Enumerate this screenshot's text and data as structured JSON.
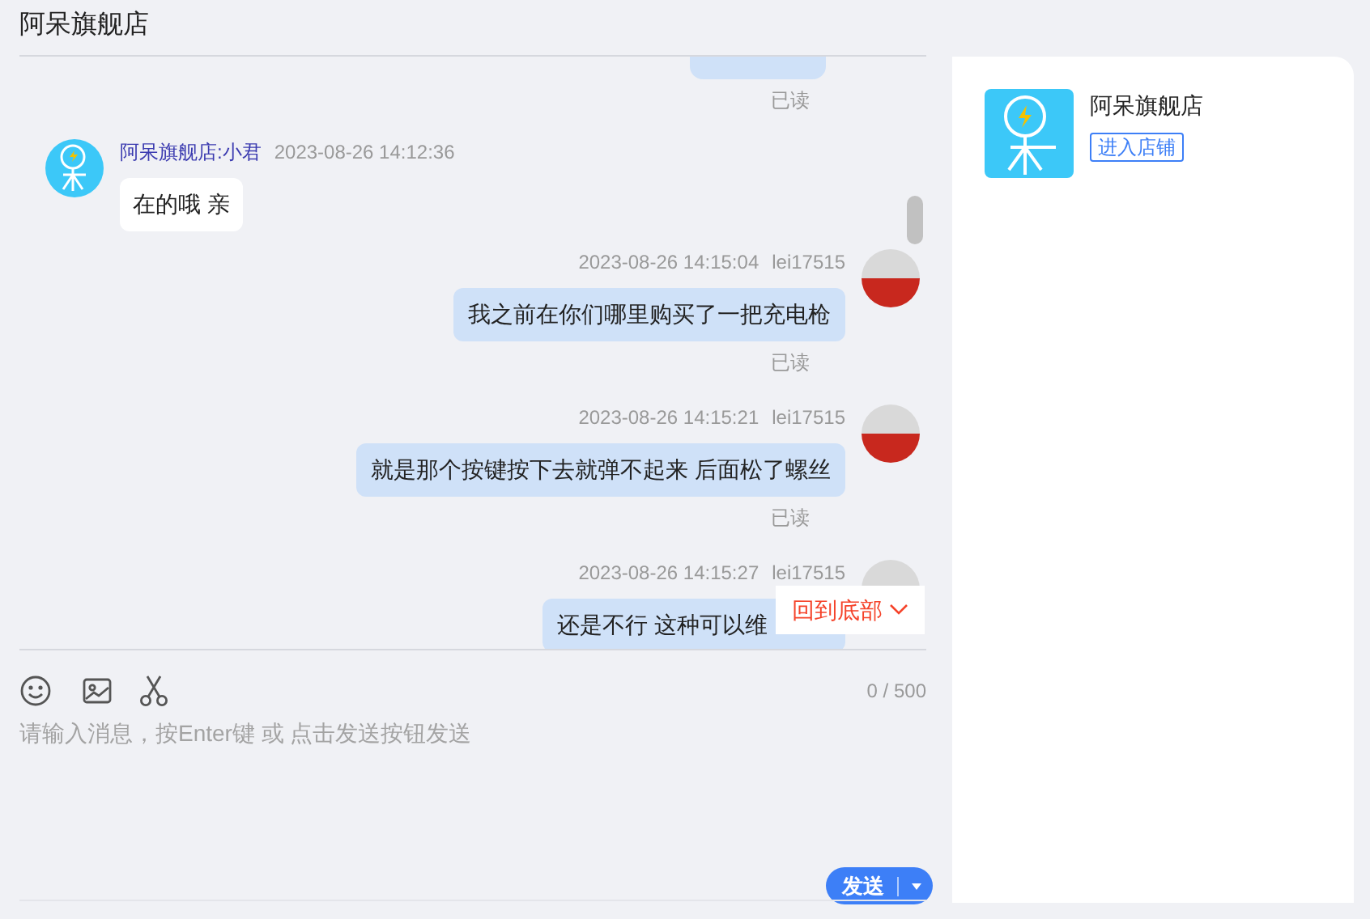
{
  "header": {
    "title": "阿呆旗舰店"
  },
  "messages": [
    {
      "kind": "partial",
      "outgoing": true,
      "read_status": "已读"
    },
    {
      "kind": "text",
      "outgoing": false,
      "sender": "阿呆旗舰店:小君",
      "time": "2023-08-26 14:12:36",
      "text": "在的哦 亲"
    },
    {
      "kind": "text",
      "outgoing": true,
      "sender": "lei17515",
      "time": "2023-08-26 14:15:04",
      "text": "我之前在你们哪里购买了一把充电枪",
      "read_status": "已读"
    },
    {
      "kind": "text",
      "outgoing": true,
      "sender": "lei17515",
      "time": "2023-08-26 14:15:21",
      "text": "就是那个按键按下去就弹不起来 后面松了螺丝",
      "read_status": "已读"
    },
    {
      "kind": "text",
      "outgoing": true,
      "sender": "lei17515",
      "time": "2023-08-26 14:15:27",
      "text": "还是不行 这种可以维"
    }
  ],
  "back_to_bottom": "回到底部",
  "composer": {
    "counter": "0 / 500",
    "placeholder": "请输入消息，按Enter键 或 点击发送按钮发送",
    "send": "发送"
  },
  "shop": {
    "name": "阿呆旗舰店",
    "enter": "进入店铺"
  }
}
